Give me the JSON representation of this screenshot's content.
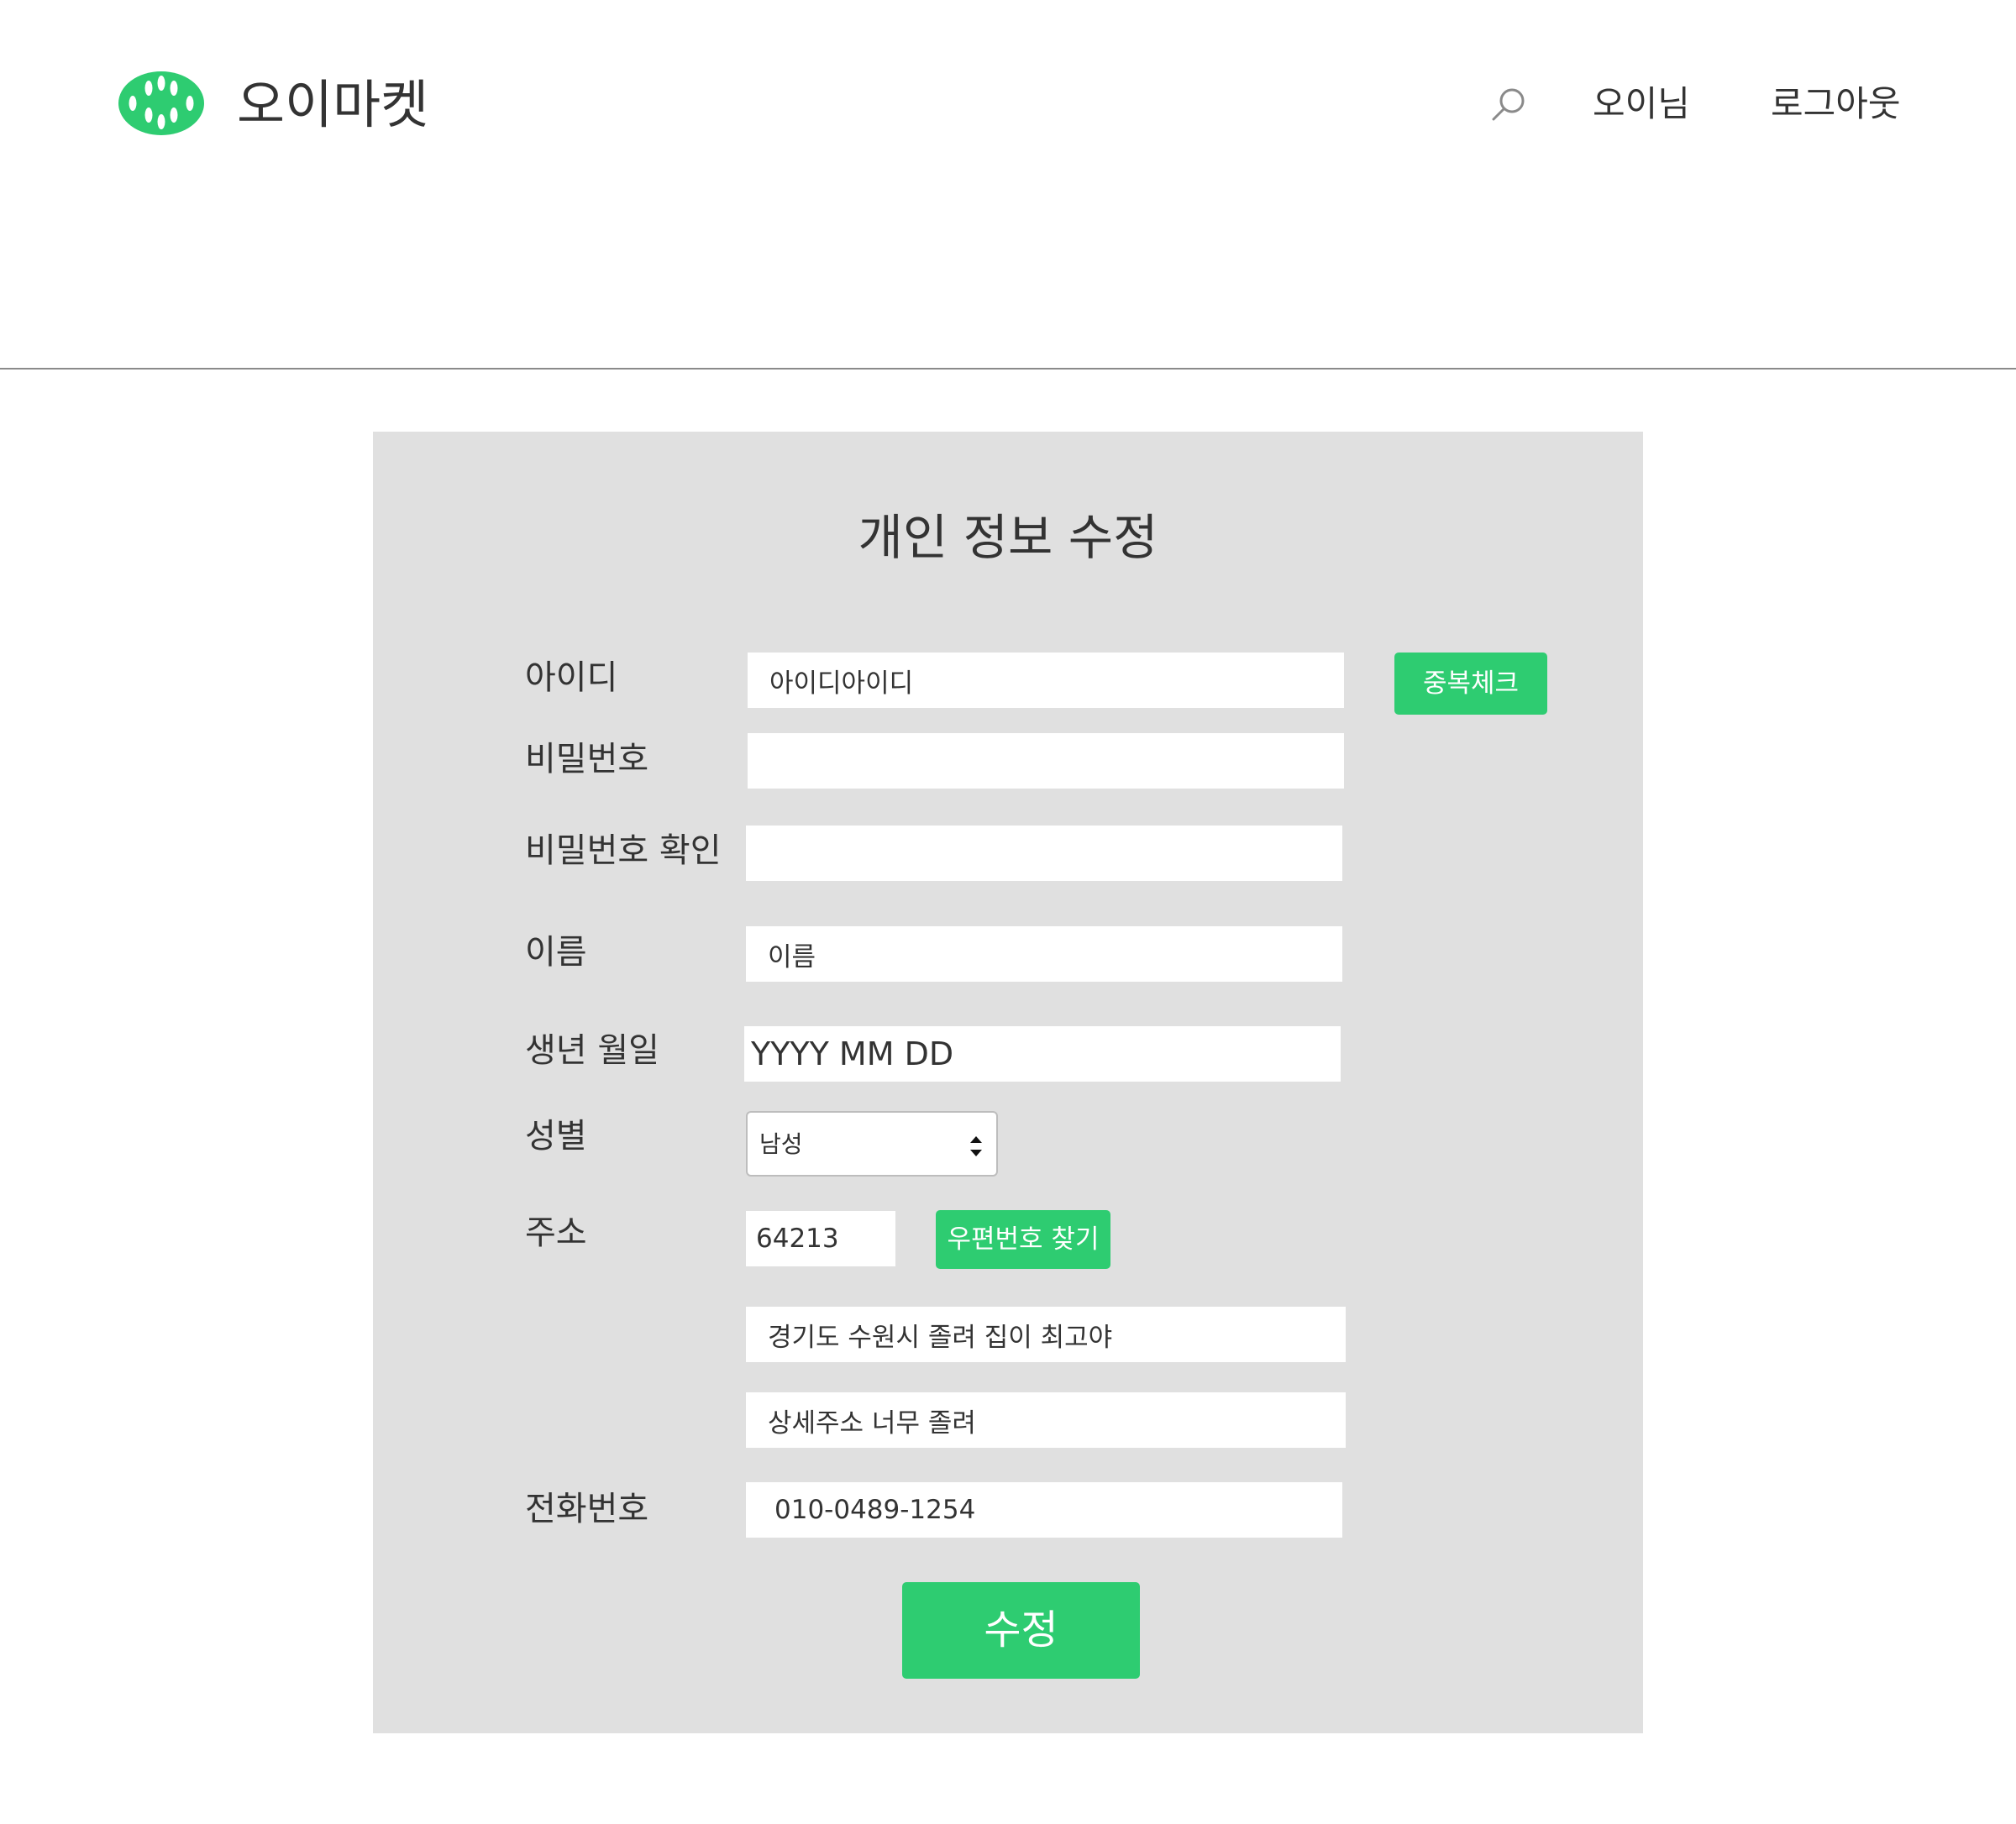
{
  "header": {
    "brand": "오이마켓",
    "user_label": "오이님",
    "logout_label": "로그아웃"
  },
  "form": {
    "title": "개인 정보 수정",
    "fields": {
      "id": {
        "label": "아이디",
        "value": "아이디아이디"
      },
      "password": {
        "label": "비밀번호",
        "value": ""
      },
      "password_confirm": {
        "label": "비밀번호 확인",
        "value": ""
      },
      "name": {
        "label": "이름",
        "value": "이름"
      },
      "birth": {
        "label": "생년 월일",
        "value": "YYYY MM DD"
      },
      "gender": {
        "label": "성별",
        "selected": "남성"
      },
      "address": {
        "label": "주소",
        "zipcode": "64213",
        "line1": "경기도 수원시 졸려 집이 최고야",
        "line2": "상세주소 너무 졸려"
      },
      "phone": {
        "label": "전화번호",
        "value": "010-0489-1254"
      }
    },
    "buttons": {
      "duplicate_check": "중복체크",
      "find_zipcode": "우편번호 찾기",
      "submit": "수정"
    }
  },
  "colors": {
    "accent": "#2ecc71",
    "panel_bg": "#e0e0e0",
    "text": "#333333"
  },
  "icons": {
    "logo": "cucumber-logo-icon",
    "search": "search-icon",
    "select": "select-arrows-icon"
  }
}
